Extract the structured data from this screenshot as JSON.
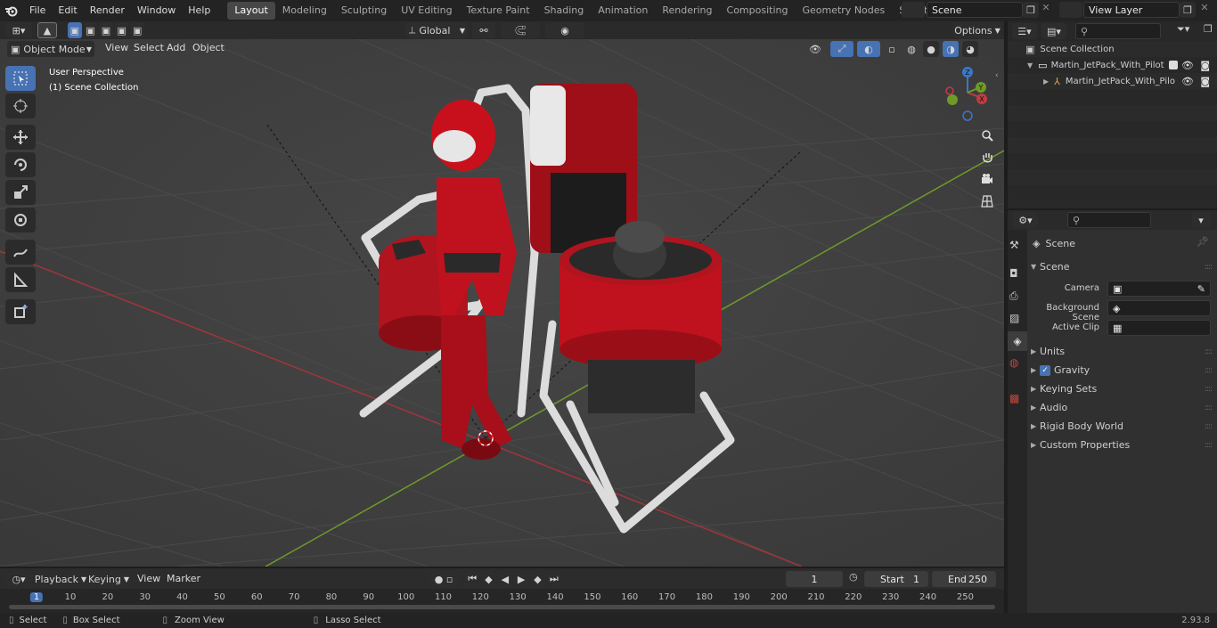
{
  "menu": {
    "file": "File",
    "edit": "Edit",
    "render": "Render",
    "window": "Window",
    "help": "Help"
  },
  "workspaces": [
    "Layout",
    "Modeling",
    "Sculpting",
    "UV Editing",
    "Texture Paint",
    "Shading",
    "Animation",
    "Rendering",
    "Compositing",
    "Geometry Nodes",
    "Scripting"
  ],
  "scene_field": "Scene",
  "view_layer_field": "View Layer",
  "viewport": {
    "transform_orientation": "Global",
    "options_label": "Options",
    "mode": "Object Mode",
    "menus": [
      "View",
      "Select",
      "Add",
      "Object"
    ],
    "overlay_title": "User Perspective",
    "overlay_sub": "(1) Scene Collection",
    "gizmo": {
      "x": "X",
      "y": "Y",
      "z": "Z"
    }
  },
  "outliner": {
    "root": "Scene Collection",
    "items": [
      {
        "label": "Martin_JetPack_With_Pilot"
      },
      {
        "label": "Martin_JetPack_With_Pilo"
      }
    ]
  },
  "properties": {
    "context": "Scene",
    "section": "Scene",
    "camera_label": "Camera",
    "bg_scene_label": "Background Scene",
    "active_clip_label": "Active Clip",
    "panels": [
      "Units",
      "Gravity",
      "Keying Sets",
      "Audio",
      "Rigid Body World",
      "Custom Properties"
    ],
    "gravity_checked": true
  },
  "timeline": {
    "menus": [
      "Playback",
      "Keying",
      "View",
      "Marker"
    ],
    "current_frame": "1",
    "start_label": "Start",
    "start_value": "1",
    "end_label": "End",
    "end_value": "250",
    "ticks": [
      "1",
      "10",
      "20",
      "30",
      "40",
      "50",
      "60",
      "70",
      "80",
      "90",
      "100",
      "110",
      "120",
      "130",
      "140",
      "150",
      "160",
      "170",
      "180",
      "190",
      "200",
      "210",
      "220",
      "230",
      "240",
      "250"
    ]
  },
  "status": {
    "select": "Select",
    "box_select": "Box Select",
    "zoom_view": "Zoom View",
    "lasso_select": "Lasso Select",
    "version": "2.93.8"
  },
  "colors": {
    "accent": "#4772b3",
    "x_axis": "#c23b45",
    "y_axis": "#6f9a2a",
    "jetpack_red": "#c0121e",
    "z_axis": "#3c78c8"
  }
}
